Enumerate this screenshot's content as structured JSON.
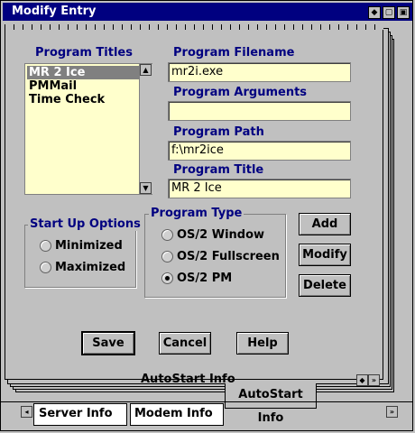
{
  "window": {
    "title": "Modify Entry"
  },
  "titlebar_buttons": [
    "◆",
    "▢",
    "▣"
  ],
  "program_titles": {
    "label": "Program Titles",
    "items": [
      "MR 2 Ice",
      "PMMail",
      "Time Check"
    ],
    "selected_index": 0
  },
  "fields": {
    "filename": {
      "label": "Program Filename",
      "value": "mr2i.exe"
    },
    "arguments": {
      "label": "Program Arguments",
      "value": ""
    },
    "path": {
      "label": "Program Path",
      "value": "f:\\mr2ice"
    },
    "title": {
      "label": "Program Title",
      "value": "MR 2 Ice"
    }
  },
  "startup": {
    "label": "Start Up Options",
    "options": [
      {
        "label": "Minimized",
        "checked": false
      },
      {
        "label": "Maximized",
        "checked": false
      }
    ]
  },
  "program_type": {
    "label": "Program Type",
    "options": [
      {
        "label": "OS/2 Window",
        "checked": false
      },
      {
        "label": "OS/2 Fullscreen",
        "checked": false
      },
      {
        "label": "OS/2 PM",
        "checked": true
      }
    ]
  },
  "side_buttons": {
    "add": "Add",
    "modify": "Modify",
    "delete": "Delete"
  },
  "bottom_buttons": {
    "save": "Save",
    "cancel": "Cancel",
    "help": "Help"
  },
  "notebook": {
    "status_text": "AutoStart Info",
    "tabs": {
      "active": "AutoStart Info",
      "server": "Server Info",
      "modem": "Modem Info"
    }
  },
  "colors": {
    "titlebar": "#000080",
    "label_text": "#000080",
    "field_bg": "#ffffcc",
    "face": "#c0c0c0"
  }
}
